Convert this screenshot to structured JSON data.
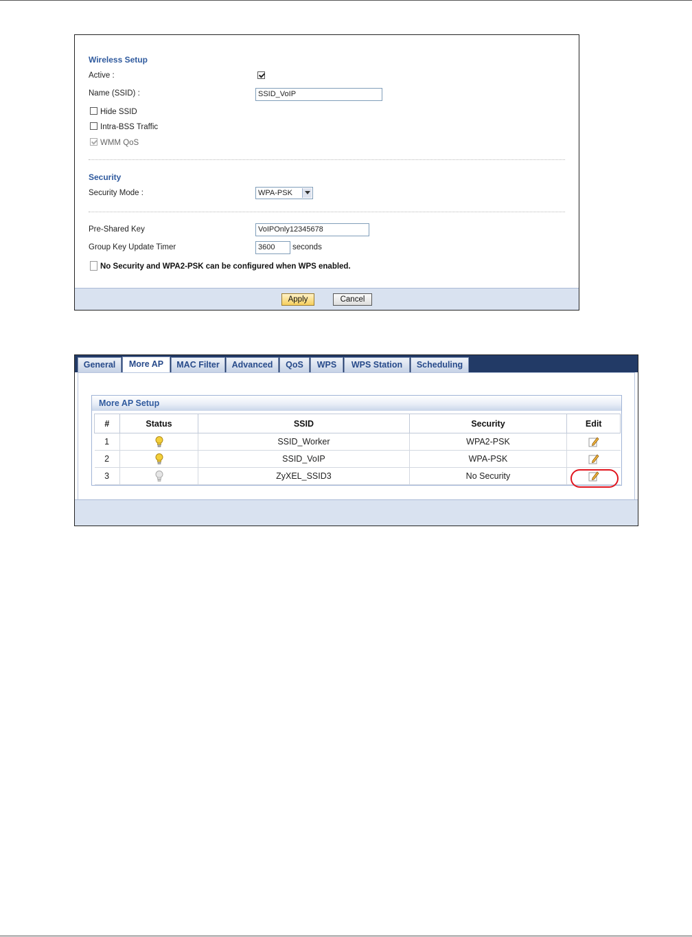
{
  "wireless_setup": {
    "title": "Wireless Setup",
    "active_label": "Active :",
    "active_checked": true,
    "ssid_label": "Name (SSID) :",
    "ssid_value": "SSID_VoIP",
    "hide_ssid_label": "Hide SSID",
    "hide_ssid_checked": false,
    "intra_bss_label": "Intra-BSS Traffic",
    "intra_bss_checked": false,
    "wmm_label": "WMM QoS",
    "wmm_checked": true
  },
  "security": {
    "title": "Security",
    "mode_label": "Security Mode :",
    "mode_value": "WPA-PSK",
    "psk_label": "Pre-Shared Key",
    "psk_value": "VoIPOnly12345678",
    "timer_label": "Group Key Update Timer",
    "timer_value": "3600",
    "timer_unit": "seconds",
    "note": "No Security and WPA2-PSK can be configured when WPS enabled."
  },
  "buttons": {
    "apply": "Apply",
    "cancel": "Cancel"
  },
  "tabs": [
    "General",
    "More AP",
    "MAC Filter",
    "Advanced",
    "QoS",
    "WPS",
    "WPS Station",
    "Scheduling"
  ],
  "active_tab": "More AP",
  "more_ap": {
    "title": "More AP Setup",
    "columns": [
      "#",
      "Status",
      "SSID",
      "Security",
      "Edit"
    ],
    "rows": [
      {
        "num": "1",
        "status": "on",
        "ssid": "SSID_Worker",
        "security": "WPA2-PSK"
      },
      {
        "num": "2",
        "status": "on",
        "ssid": "SSID_VoIP",
        "security": "WPA-PSK"
      },
      {
        "num": "3",
        "status": "off",
        "ssid": "ZyXEL_SSID3",
        "security": "No Security"
      }
    ]
  },
  "colors": {
    "bulb_on": "#f3cf3a",
    "bulb_off": "#d4d4d4",
    "highlight": "#e1141d",
    "accent": "#2f5a9e"
  }
}
